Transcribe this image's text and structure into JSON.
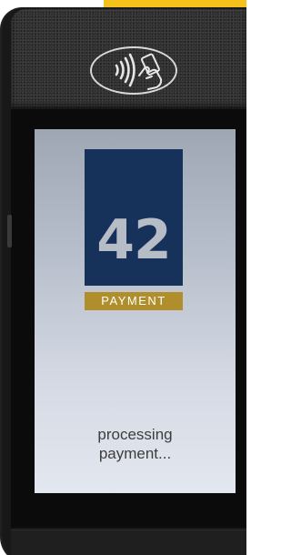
{
  "accent_color": "#f5c21b",
  "device": {
    "contactless_icon": "contactless-tap-icon",
    "screen": {
      "logo": {
        "number": "42",
        "band_label": "PAYMENT",
        "block_color": "#17325a",
        "band_color": "#b08e2c"
      },
      "status": {
        "line1": "processing",
        "line2": "payment..."
      }
    }
  }
}
